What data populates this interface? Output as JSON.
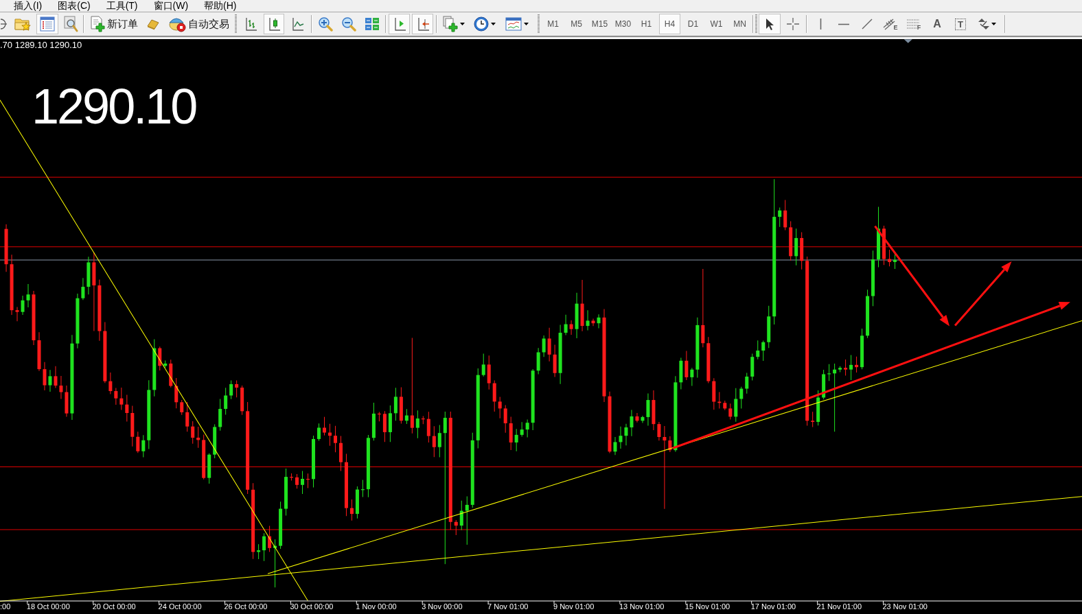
{
  "menu_bar": [
    "插入(I)",
    "图表(C)",
    "工具(T)",
    "窗口(W)",
    "帮助(H)"
  ],
  "toolbar": {
    "market_watch": {
      "on": true
    },
    "data_window": {
      "on": false
    },
    "new_order": {
      "label": "新订单"
    },
    "auto_trading": {
      "label": "自动交易"
    },
    "chart_types": [
      {
        "kind": "bars",
        "selected": false
      },
      {
        "kind": "candles",
        "selected": true
      },
      {
        "kind": "line",
        "selected": false
      }
    ],
    "auto_scroll": {
      "on": true
    },
    "chart_shift": {
      "on": true
    },
    "timeframes": [
      {
        "label": "M1",
        "selected": false
      },
      {
        "label": "M5",
        "selected": false
      },
      {
        "label": "M15",
        "selected": false
      },
      {
        "label": "M30",
        "selected": false
      },
      {
        "label": "H1",
        "selected": false
      },
      {
        "label": "H4",
        "selected": true
      },
      {
        "label": "D1",
        "selected": false
      },
      {
        "label": "W1",
        "selected": false
      },
      {
        "label": "MN",
        "selected": false
      }
    ],
    "drawing_tools": [
      {
        "kind": "cursor",
        "selected": true
      },
      {
        "kind": "crosshair",
        "selected": false
      },
      {
        "kind": "vertical_line",
        "selected": false
      },
      {
        "kind": "horizontal_line",
        "selected": false
      },
      {
        "kind": "trend_line",
        "selected": false
      },
      {
        "kind": "channel",
        "glyph": "E",
        "selected": false
      },
      {
        "kind": "fibonacci",
        "glyph": "F",
        "selected": false
      },
      {
        "kind": "text",
        "glyph": "A",
        "selected": false
      },
      {
        "kind": "text_label",
        "glyph": "T",
        "selected": false
      },
      {
        "kind": "arrows",
        "selected": false
      }
    ]
  },
  "chart": {
    "ohlc_line": ".70 1289.10 1290.10",
    "price": "1290.10",
    "time_axis": [
      ":00",
      "18 Oct 00:00",
      "20 Oct 00:00",
      "24 Oct 00:00",
      "26 Oct 00:00",
      "30 Oct 00:00",
      "1 Nov 00:00",
      "3 Nov 00:00",
      "7 Nov 01:00",
      "9 Nov 01:00",
      "13 Nov 01:00",
      "15 Nov 01:00",
      "17 Nov 01:00",
      "21 Nov 01:00",
      "23 Nov 01:00"
    ]
  }
}
